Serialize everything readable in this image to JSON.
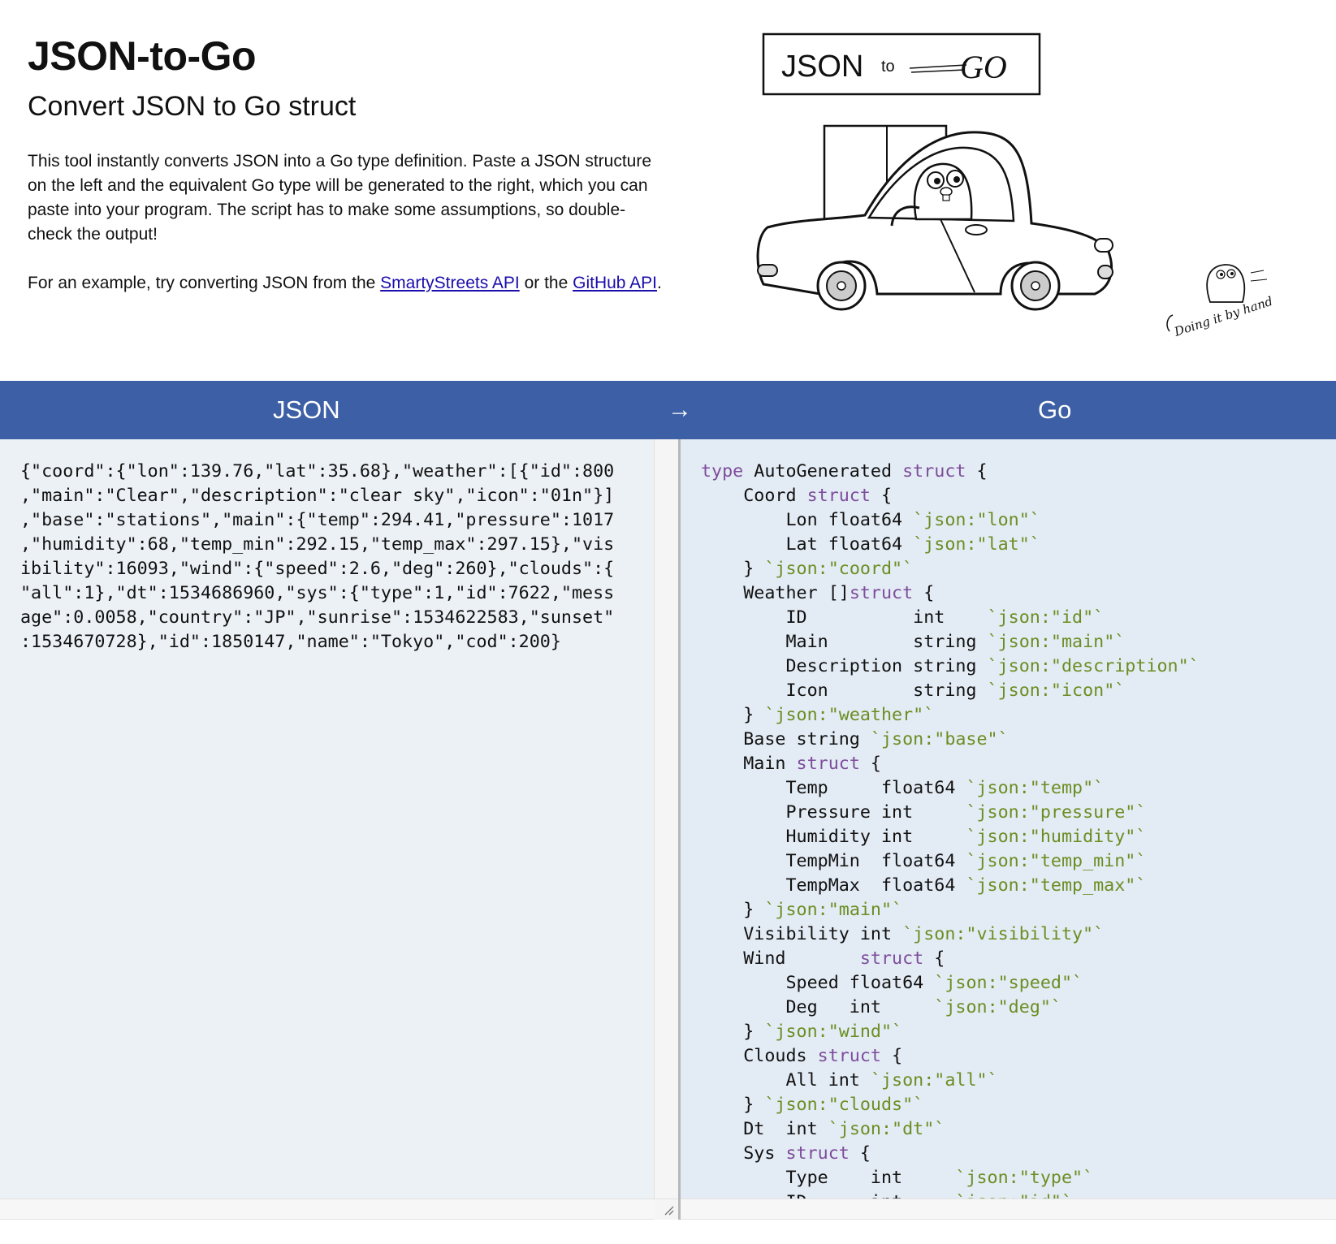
{
  "header": {
    "title": "JSON-to-Go",
    "subtitle": "Convert JSON to Go struct",
    "description": "This tool instantly converts JSON into a Go type definition. Paste a JSON structure on the left and the equivalent Go type will be generated to the right, which you can paste into your program. The script has to make some assumptions, so double-check the output!",
    "example_prefix": "For an example, try converting JSON from the ",
    "example_link1": "SmartyStreets API",
    "example_mid": " or the ",
    "example_link2": "GitHub API",
    "example_suffix": "."
  },
  "logo": {
    "json": "JSON",
    "to": "to",
    "go": "GO"
  },
  "caption": "Doing it by hand",
  "bar": {
    "left_label": "JSON",
    "arrow": "→",
    "right_label": "Go"
  },
  "colors": {
    "bar": "#3d5fa6",
    "left_pane": "#ecf1f5",
    "right_pane": "#e3ebf4",
    "keyword": "#7d4d9b",
    "tag": "#6b8e23"
  },
  "json_input": "{\"coord\":{\"lon\":139.76,\"lat\":35.68},\"weather\":[{\"id\":800\n,\"main\":\"Clear\",\"description\":\"clear sky\",\"icon\":\"01n\"}]\n,\"base\":\"stations\",\"main\":{\"temp\":294.41,\"pressure\":1017\n,\"humidity\":68,\"temp_min\":292.15,\"temp_max\":297.15},\"vis\nibility\":16093,\"wind\":{\"speed\":2.6,\"deg\":260},\"clouds\":{\n\"all\":1},\"dt\":1534686960,\"sys\":{\"type\":1,\"id\":7622,\"mess\nage\":0.0058,\"country\":\"JP\",\"sunrise\":1534622583,\"sunset\"\n:1534670728},\"id\":1850147,\"name\":\"Tokyo\",\"cod\":200}",
  "go_output": [
    [
      [
        "",
        "kw",
        "type"
      ],
      [
        "",
        "t",
        " AutoGenerated "
      ],
      [
        "",
        "kw",
        "struct"
      ],
      [
        "",
        "t",
        " {"
      ]
    ],
    [
      [
        "    ",
        "t",
        "Coord "
      ],
      [
        "",
        "kw",
        "struct"
      ],
      [
        "",
        "t",
        " {"
      ]
    ],
    [
      [
        "        ",
        "t",
        "Lon float64 "
      ],
      [
        "",
        "tag",
        "`json:\"lon\"`"
      ]
    ],
    [
      [
        "        ",
        "t",
        "Lat float64 "
      ],
      [
        "",
        "tag",
        "`json:\"lat\"`"
      ]
    ],
    [
      [
        "    ",
        "t",
        "} "
      ],
      [
        "",
        "tag",
        "`json:\"coord\"`"
      ]
    ],
    [
      [
        "    ",
        "t",
        "Weather []"
      ],
      [
        "",
        "kw",
        "struct"
      ],
      [
        "",
        "t",
        " {"
      ]
    ],
    [
      [
        "        ",
        "t",
        "ID          int    "
      ],
      [
        "",
        "tag",
        "`json:\"id\"`"
      ]
    ],
    [
      [
        "        ",
        "t",
        "Main        string "
      ],
      [
        "",
        "tag",
        "`json:\"main\"`"
      ]
    ],
    [
      [
        "        ",
        "t",
        "Description string "
      ],
      [
        "",
        "tag",
        "`json:\"description\"`"
      ]
    ],
    [
      [
        "        ",
        "t",
        "Icon        string "
      ],
      [
        "",
        "tag",
        "`json:\"icon\"`"
      ]
    ],
    [
      [
        "    ",
        "t",
        "} "
      ],
      [
        "",
        "tag",
        "`json:\"weather\"`"
      ]
    ],
    [
      [
        "    ",
        "t",
        "Base string "
      ],
      [
        "",
        "tag",
        "`json:\"base\"`"
      ]
    ],
    [
      [
        "    ",
        "t",
        "Main "
      ],
      [
        "",
        "kw",
        "struct"
      ],
      [
        "",
        "t",
        " {"
      ]
    ],
    [
      [
        "        ",
        "t",
        "Temp     float64 "
      ],
      [
        "",
        "tag",
        "`json:\"temp\"`"
      ]
    ],
    [
      [
        "        ",
        "t",
        "Pressure int     "
      ],
      [
        "",
        "tag",
        "`json:\"pressure\"`"
      ]
    ],
    [
      [
        "        ",
        "t",
        "Humidity int     "
      ],
      [
        "",
        "tag",
        "`json:\"humidity\"`"
      ]
    ],
    [
      [
        "        ",
        "t",
        "TempMin  float64 "
      ],
      [
        "",
        "tag",
        "`json:\"temp_min\"`"
      ]
    ],
    [
      [
        "        ",
        "t",
        "TempMax  float64 "
      ],
      [
        "",
        "tag",
        "`json:\"temp_max\"`"
      ]
    ],
    [
      [
        "    ",
        "t",
        "} "
      ],
      [
        "",
        "tag",
        "`json:\"main\"`"
      ]
    ],
    [
      [
        "    ",
        "t",
        "Visibility int "
      ],
      [
        "",
        "tag",
        "`json:\"visibility\"`"
      ]
    ],
    [
      [
        "    ",
        "t",
        "Wind       "
      ],
      [
        "",
        "kw",
        "struct"
      ],
      [
        "",
        "t",
        " {"
      ]
    ],
    [
      [
        "        ",
        "t",
        "Speed float64 "
      ],
      [
        "",
        "tag",
        "`json:\"speed\"`"
      ]
    ],
    [
      [
        "        ",
        "t",
        "Deg   int     "
      ],
      [
        "",
        "tag",
        "`json:\"deg\"`"
      ]
    ],
    [
      [
        "    ",
        "t",
        "} "
      ],
      [
        "",
        "tag",
        "`json:\"wind\"`"
      ]
    ],
    [
      [
        "    ",
        "t",
        "Clouds "
      ],
      [
        "",
        "kw",
        "struct"
      ],
      [
        "",
        "t",
        " {"
      ]
    ],
    [
      [
        "        ",
        "t",
        "All int "
      ],
      [
        "",
        "tag",
        "`json:\"all\"`"
      ]
    ],
    [
      [
        "    ",
        "t",
        "} "
      ],
      [
        "",
        "tag",
        "`json:\"clouds\"`"
      ]
    ],
    [
      [
        "    ",
        "t",
        "Dt  int "
      ],
      [
        "",
        "tag",
        "`json:\"dt\"`"
      ]
    ],
    [
      [
        "    ",
        "t",
        "Sys "
      ],
      [
        "",
        "kw",
        "struct"
      ],
      [
        "",
        "t",
        " {"
      ]
    ],
    [
      [
        "        ",
        "t",
        "Type    int     "
      ],
      [
        "",
        "tag",
        "`json:\"type\"`"
      ]
    ],
    [
      [
        "        ",
        "t",
        "ID      int     "
      ],
      [
        "",
        "tag",
        "`json:\"id\"`"
      ]
    ]
  ]
}
